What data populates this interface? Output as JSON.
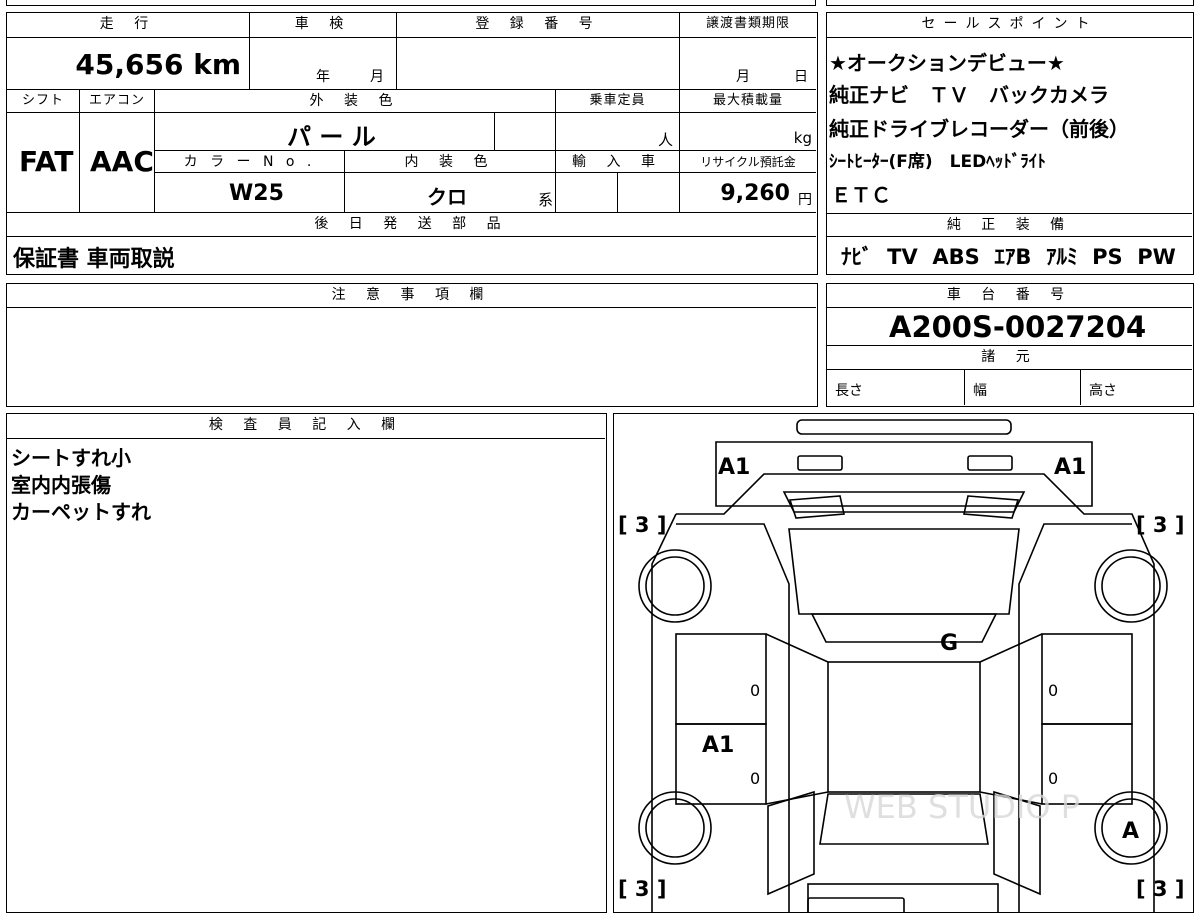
{
  "top": {
    "mileage_header": "走 行",
    "mileage_value": "45,656 km",
    "shaken_header": "車 検",
    "shaken_year": "年",
    "shaken_month": "月",
    "reg_header": "登 録 番 号",
    "transfer_header": "譲渡書類期限",
    "transfer_month": "月",
    "transfer_day": "日",
    "shift_header": "シフト",
    "shift_value": "FAT",
    "ac_header": "エアコン",
    "ac_value": "AAC",
    "exterior_header": "外 装 色",
    "exterior_value": "パ ー ル",
    "capacity_header": "乗車定員",
    "capacity_unit": "人",
    "load_header": "最大積載量",
    "load_unit": "kg",
    "color_no_header": "カ ラ ー N o .",
    "color_no_value": "W25",
    "interior_header": "内 装 色",
    "interior_value": "クロ",
    "interior_suffix": "系",
    "import_header": "輸 入 車",
    "recycle_header": "リサイクル預託金",
    "recycle_value": "9,260",
    "recycle_unit": "円",
    "later_parts_header": "後 日 発 送 部 品",
    "later_parts_value": "保証書 車両取説"
  },
  "sales": {
    "header": "セールスポイント",
    "lines": [
      "★オークションデビュー★",
      "純正ナビ　ＴＶ　バックカメラ",
      "純正ドライブレコーダー（前後）",
      "ｼｰﾄﾋｰﾀｰ(F席)　LEDﾍｯﾄﾞﾗｲﾄ",
      "ＥＴＣ"
    ],
    "equip_header": "純 正 装 備",
    "equip_value": "ﾅﾋﾞ  TV  ABS  ｴｱB  ｱﾙﾐ  PS  PW"
  },
  "notes": {
    "header": "注 意 事 項 欄"
  },
  "chassis": {
    "header": "車 台 番 号",
    "value": "A200S-0027204",
    "spec_header": "諸 元",
    "length": "長さ",
    "width": "幅",
    "height": "高さ"
  },
  "inspector": {
    "header": "検 査 員 記 入 欄",
    "lines": [
      "シートすれ小",
      "室内内張傷",
      "カーペットすれ"
    ]
  },
  "diagram": {
    "marks": {
      "front_left": "A1",
      "front_right": "A1",
      "roof": "G",
      "left_door_panel": "A1",
      "rear_right_wheel": "A",
      "left_door_front": "0",
      "left_door_rear": "0",
      "right_door_front": "0",
      "right_door_rear": "0"
    },
    "tire_front_left": "[ 3 ]",
    "tire_front_right": "[ 3 ]",
    "tire_rear_left": "[ 3 ]",
    "tire_rear_right": "[ 3 ]",
    "watermark": "WEB STUDIO P"
  }
}
